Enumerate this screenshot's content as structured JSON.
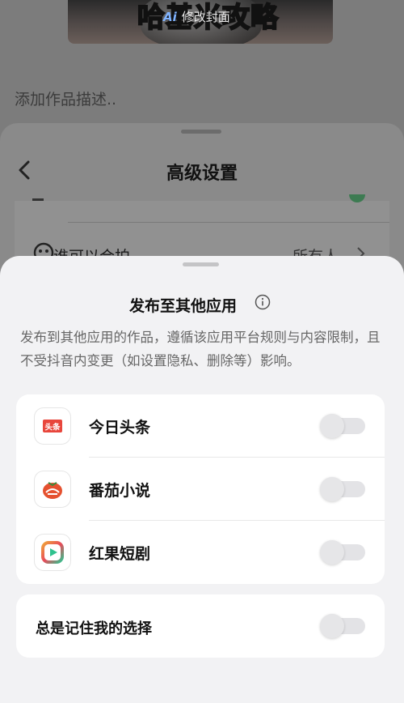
{
  "background": {
    "cover": {
      "ai_badge": "Ai",
      "edit_cover_label": "修改封面",
      "overlay_text": "哈基米攻略"
    },
    "description_placeholder": "添加作品描述.."
  },
  "advanced_settings": {
    "title": "高级设置",
    "row": {
      "label": "谁可以合拍",
      "value": "所有人"
    }
  },
  "publish_sheet": {
    "title": "发布至其他应用",
    "description": "发布到其他应用的作品，遵循该应用平台规则与内容限制，且不受抖音内变更（如设置隐私、删除等）影响。",
    "apps": [
      {
        "name": "今日头条",
        "icon": "toutiao-icon",
        "icon_text": "头条",
        "enabled": false
      },
      {
        "name": "番茄小说",
        "icon": "fanqie-novel-icon",
        "enabled": false
      },
      {
        "name": "红果短剧",
        "icon": "hongguo-drama-icon",
        "enabled": false
      }
    ],
    "remember_choice": {
      "label": "总是记住我的选择",
      "enabled": false
    }
  },
  "colors": {
    "sheet_bg": "#f2f2f4",
    "card_bg": "#ffffff",
    "toutiao_red": "#e8463c",
    "fanqie_red": "#e5512f",
    "hongguo_green": "#2fc28e",
    "toggle_off": "#e3e3e6"
  }
}
